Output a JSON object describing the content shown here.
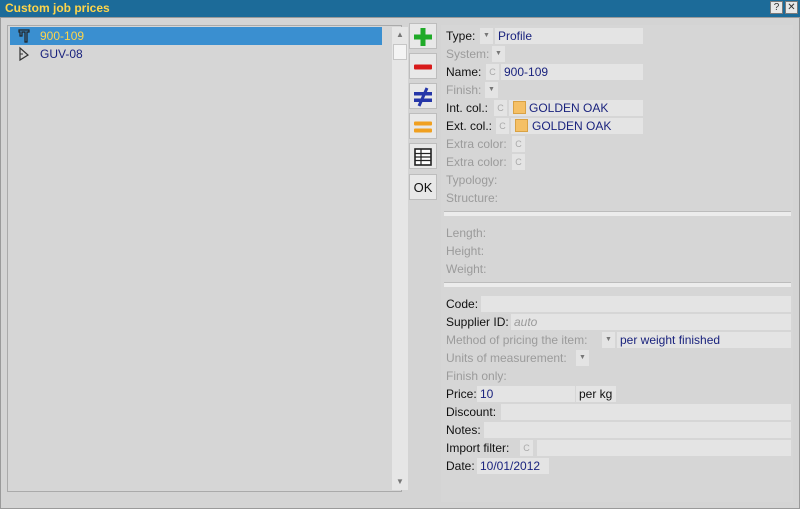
{
  "window": {
    "title": "Custom job prices",
    "help_label": "?",
    "close_label": "✕"
  },
  "tree": {
    "items": [
      {
        "label": "900-109",
        "selected": true,
        "icon": "profile-icon"
      },
      {
        "label": "GUV-08",
        "selected": false,
        "icon": "accessory-icon"
      }
    ]
  },
  "toolbar": {
    "add": "plus-icon",
    "remove": "minus-icon",
    "replace": "not-equal-icon",
    "equal": "equal-icon",
    "table": "table-icon",
    "ok_label": "OK"
  },
  "props": {
    "type_label": "Type:",
    "type_value": "Profile",
    "system_label": "System:",
    "name_label": "Name:",
    "name_value": "900-109",
    "finish_label": "Finish:",
    "intcol_label": "Int. col.:",
    "intcol_value": "GOLDEN OAK",
    "extcol_label": "Ext. col.:",
    "extcol_value": "GOLDEN OAK",
    "extra1_label": "Extra color:",
    "extra2_label": "Extra color:",
    "typology_label": "Typology:",
    "structure_label": "Structure:",
    "length_label": "Length:",
    "height_label": "Height:",
    "weight_label": "Weight:",
    "code_label": "Code:",
    "code_value": "",
    "supplier_label": "Supplier ID:",
    "supplier_placeholder": "auto",
    "method_label": "Method of pricing the item:",
    "method_value": "per weight finished",
    "units_label": "Units of measurement:",
    "finish_only_label": "Finish only:",
    "price_label": "Price:",
    "price_value": "10",
    "price_unit": "per kg",
    "discount_label": "Discount:",
    "discount_value": "",
    "notes_label": "Notes:",
    "notes_value": "",
    "import_label": "Import filter:",
    "import_value": "",
    "date_label": "Date:",
    "date_value": "10/01/2012",
    "c_mark": "C",
    "dd_mark": "▼",
    "color_swatch": "#f5c065"
  }
}
